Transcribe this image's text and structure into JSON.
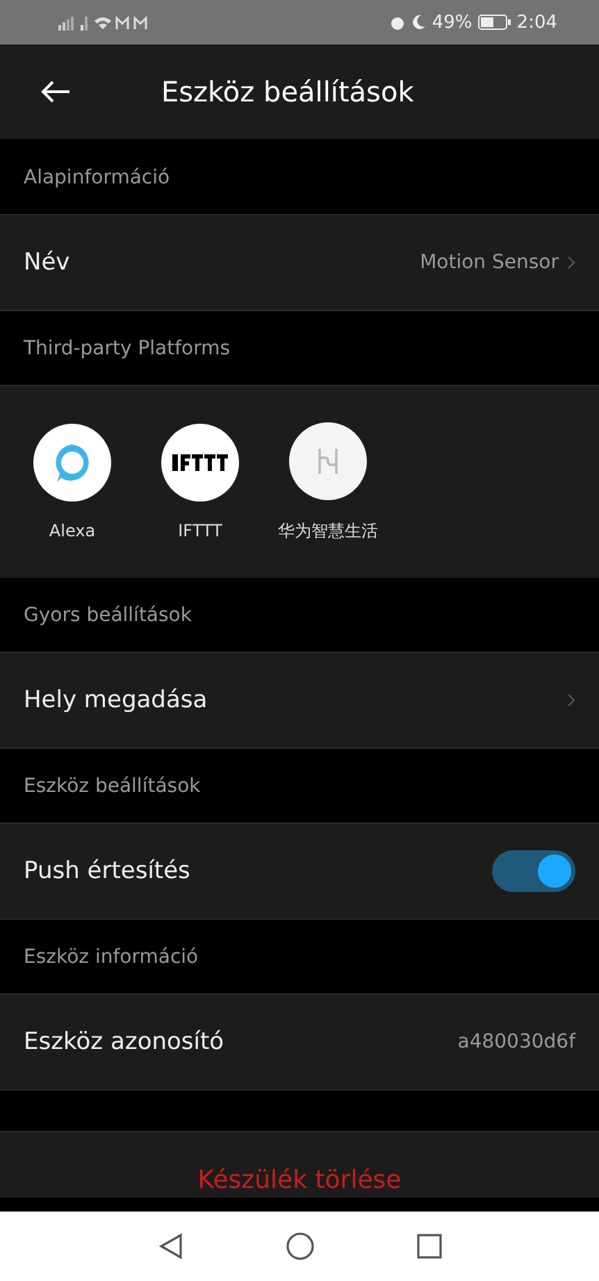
{
  "status_bar": {
    "battery": "49%",
    "time": "2:04"
  },
  "header": {
    "title": "Eszköz beállítások"
  },
  "sections": [
    {
      "title": "Alapinformáció",
      "rows": [
        {
          "kind": "link",
          "label": "Név",
          "value": "Motion Sensor"
        }
      ]
    },
    {
      "title": "Third-party Platforms",
      "rows": [
        {
          "kind": "platforms",
          "platforms": [
            {
              "kind": "alexa",
              "label": "Alexa"
            },
            {
              "kind": "ifttt",
              "label": "IFTTT"
            },
            {
              "kind": "huawei",
              "label": "华为智慧生活"
            }
          ]
        }
      ]
    },
    {
      "title": "Gyors beállítások",
      "rows": [
        {
          "kind": "link",
          "label": "Hely megadása"
        }
      ]
    },
    {
      "title": "Eszköz beállítások",
      "rows": [
        {
          "kind": "toggle",
          "label": "Push értesítés",
          "on": true
        }
      ]
    },
    {
      "title": "Eszköz információ",
      "rows": [
        {
          "kind": "info",
          "label": "Eszköz azonosító",
          "value": "a480030d6f"
        }
      ]
    }
  ],
  "delete_button": "Készülék törlése"
}
